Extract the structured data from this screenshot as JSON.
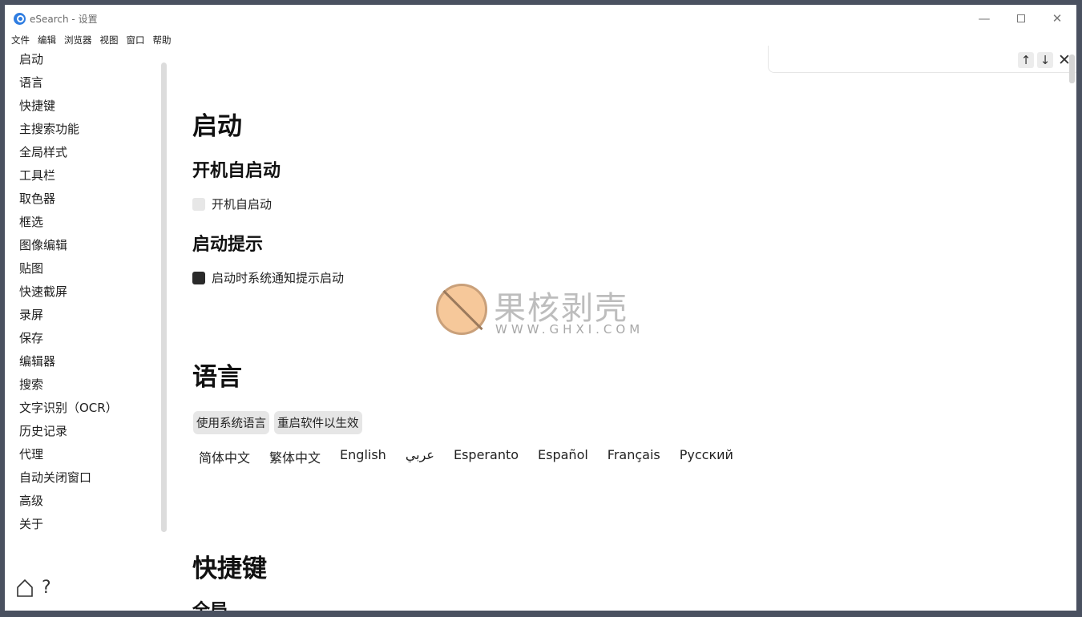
{
  "window": {
    "title": "eSearch - 设置",
    "min": "—",
    "close": "✕"
  },
  "menu": [
    "文件",
    "编辑",
    "浏览器",
    "视图",
    "窗口",
    "帮助"
  ],
  "sidebar": {
    "items": [
      "启动",
      "语言",
      "快捷键",
      "主搜索功能",
      "全局样式",
      "工具栏",
      "取色器",
      "框选",
      "图像编辑",
      "贴图",
      "快速截屏",
      "录屏",
      "保存",
      "编辑器",
      "搜索",
      "文字识别（OCR）",
      "历史记录",
      "代理",
      "自动关闭窗口",
      "高级",
      "关于"
    ],
    "help": "?"
  },
  "find": {
    "up": "↑",
    "down": "↓",
    "close": "✕"
  },
  "sections": {
    "startup": {
      "title": "启动",
      "autostart_heading": "开机自启动",
      "autostart_label": "开机自启动",
      "autostart_checked": false,
      "hint_heading": "启动提示",
      "hint_label": "启动时系统通知提示启动",
      "hint_checked": true
    },
    "language": {
      "title": "语言",
      "btn_system": "使用系统语言",
      "btn_restart": "重启软件以生效",
      "options": [
        "简体中文",
        "繁体中文",
        "English",
        "عربي",
        "Esperanto",
        "Español",
        "Français",
        "Русский"
      ]
    },
    "shortcuts": {
      "title": "快捷键",
      "sub_heading": "全局"
    }
  },
  "watermark": {
    "cn": "果核剥壳",
    "url": "WWW.GHXI.COM"
  }
}
